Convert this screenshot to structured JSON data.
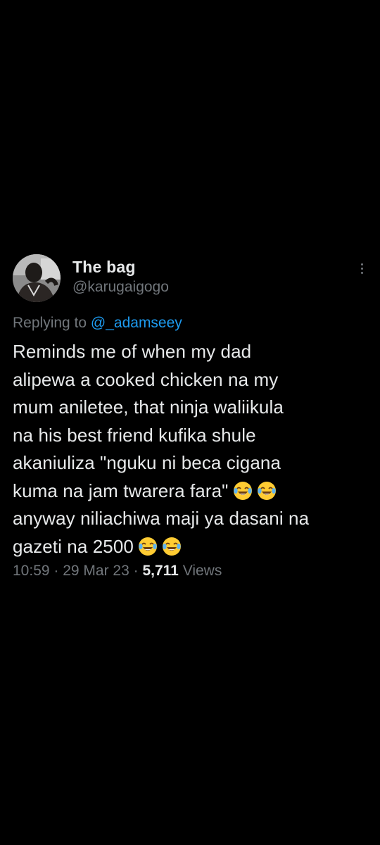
{
  "tweet": {
    "author": {
      "display_name": "The bag",
      "handle": "@karugaigogo"
    },
    "replying_prefix": "Replying to",
    "replying_handle": "@_adamseey",
    "lines": [
      "Reminds me of when my dad",
      "alipewa a cooked chicken na my",
      "mum aniletee, that ninja waliikula",
      "na his best friend kufika shule",
      "akaniuliza \"nguku ni beca cigana",
      "kuma na jam twarera fara\"",
      "anyway niliachiwa maji ya dasani na",
      "gazeti na 2500"
    ],
    "emoji_name": "face-with-tears-of-joy-icon",
    "time": "10:59",
    "separator": " · ",
    "date": "29 Mar 23",
    "views_count": "5,711",
    "views_label": " Views"
  },
  "colors": {
    "background": "#000000",
    "primary_text": "#e7e9ea",
    "secondary_text": "#71767b",
    "link": "#1d9bf0"
  }
}
